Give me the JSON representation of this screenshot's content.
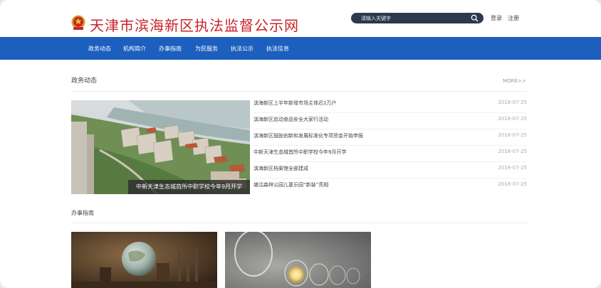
{
  "header": {
    "site_title": "天津市滨海新区执法监督公示网",
    "search_placeholder": "请输入关键字",
    "login": "登录",
    "register": "注册"
  },
  "nav": {
    "items": [
      "政务动态",
      "机构简介",
      "办事指南",
      "为民服务",
      "执法公示",
      "执法信息"
    ]
  },
  "news_section": {
    "title": "政务动态",
    "more": "MORE>>",
    "featured_caption": "中新天津生态城首所中职学校今年9月开学",
    "items": [
      {
        "title": "滨海新区上半年新增市场主体近2万户",
        "date": "2018-07-25"
      },
      {
        "title": "滨海新区启动食品安全大家行活动",
        "date": "2018-07-25"
      },
      {
        "title": "滨海新区鼓励创新和发展标准化专项资金开始申报",
        "date": "2018-07-25"
      },
      {
        "title": "中新天津生态城首所中职学校今年9月开学",
        "date": "2018-07-25"
      },
      {
        "title": "滨海新区档案馆全部建成",
        "date": "2018-07-25"
      },
      {
        "title": "塘沽森林公园儿童乐园“新装”亮相",
        "date": "2018-07-25"
      }
    ]
  },
  "guide_section": {
    "title": "办事指南"
  },
  "colors": {
    "brand_red": "#c8232c",
    "nav_blue": "#1c5fbe",
    "search_dark": "#2b3a4d"
  }
}
